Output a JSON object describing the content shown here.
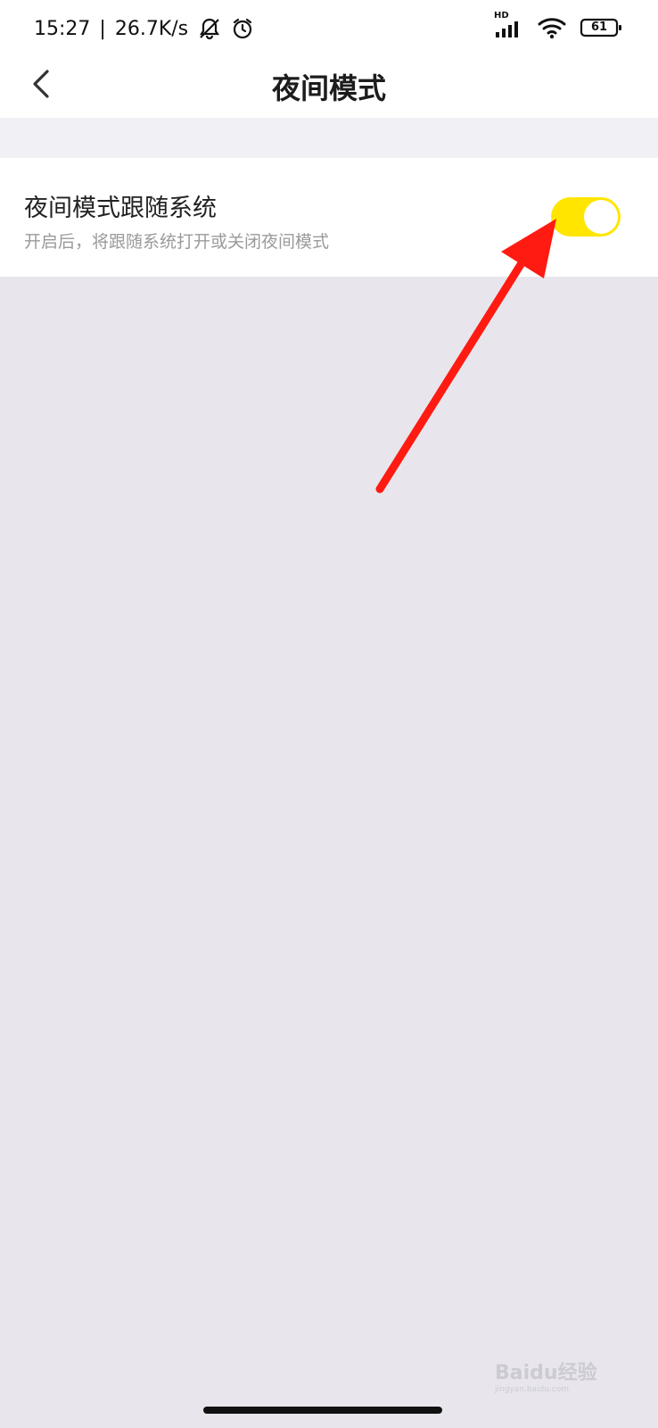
{
  "status_bar": {
    "time": "15:27",
    "separator": "|",
    "net_speed": "26.7K/s",
    "icons": [
      "bell-off-icon",
      "alarm-icon"
    ],
    "right_icons": [
      "hd-signal-icon",
      "wifi-icon",
      "battery-icon"
    ],
    "hd_label": "HD",
    "battery_level": "61"
  },
  "header": {
    "title": "夜间模式",
    "back_icon": "chevron-left-icon"
  },
  "setting": {
    "title": "夜间模式跟随系统",
    "description": "开启后，将跟随系统打开或关闭夜间模式",
    "toggle_on": true,
    "toggle_color": "#ffe500"
  },
  "annotation": {
    "arrow_color": "#ff1a12"
  },
  "watermark": {
    "text": "Baidu经验",
    "sub": "jingyan.baidu.com"
  },
  "colors": {
    "page_bg": "#e8e6ec",
    "band_bg": "#f1f1f5",
    "card_bg": "#ffffff"
  }
}
